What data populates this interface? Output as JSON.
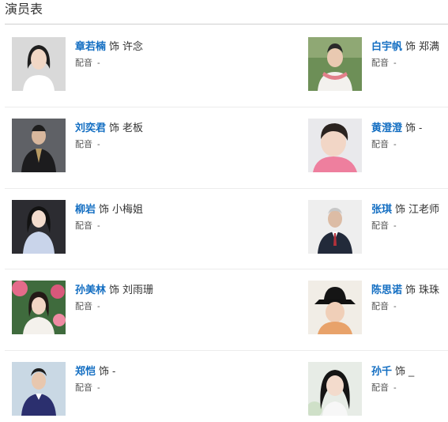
{
  "section": {
    "title": "演员表"
  },
  "labels": {
    "as": "饰",
    "dub": "配音",
    "dub_value": "-"
  },
  "cast": [
    {
      "actor": "章若楠",
      "role": "许念"
    },
    {
      "actor": "白宇帆",
      "role": "郑满"
    },
    {
      "actor": "刘奕君",
      "role": "老板"
    },
    {
      "actor": "黄澄澄",
      "role": "-"
    },
    {
      "actor": "柳岩",
      "role": "小梅姐"
    },
    {
      "actor": "张琪",
      "role": "江老师"
    },
    {
      "actor": "孙美林",
      "role": "刘雨珊"
    },
    {
      "actor": "陈思诺",
      "role": "珠珠"
    },
    {
      "actor": "郑恺",
      "role": "-"
    },
    {
      "actor": "孙千",
      "role": "_"
    }
  ],
  "colors": {
    "actor_link": "#136ec2",
    "divider": "#ececec"
  }
}
